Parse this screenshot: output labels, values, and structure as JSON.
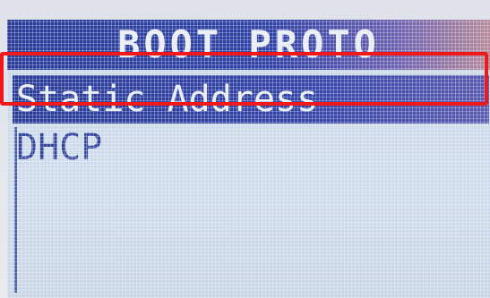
{
  "screen": {
    "title": "BOOT PROTO"
  },
  "menu": {
    "items": [
      {
        "label": "Static Address",
        "selected": true
      },
      {
        "label": "DHCP",
        "selected": false
      }
    ]
  },
  "colors": {
    "highlight_frame": "#f01818",
    "selection_bg": "#2a3c98",
    "lcd_bg": "#cfdced",
    "text_dark": "#34459e",
    "text_light": "#e8ecf6"
  }
}
